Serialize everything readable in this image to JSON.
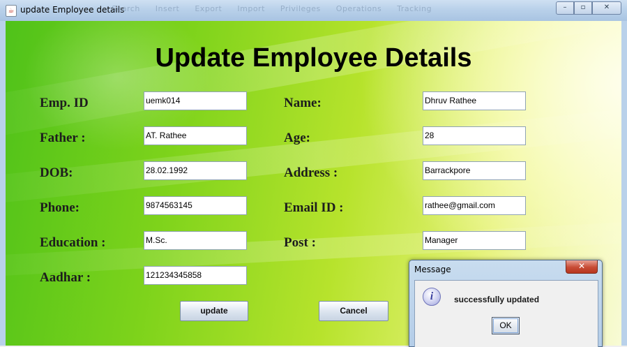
{
  "window": {
    "title": "update Employee details",
    "icon": "java-cup-icon",
    "background_toolbar_ghost": [
      "Search",
      "Insert",
      "Export",
      "Import",
      "Privileges",
      "Operations",
      "Tracking"
    ],
    "controls": {
      "minimize": "–",
      "maximize": "▫",
      "close": "✕"
    }
  },
  "form": {
    "heading": "Update Employee Details",
    "left_fields": [
      {
        "label": "Emp. ID",
        "value": "uemk014"
      },
      {
        "label": "Father :",
        "value": "AT. Rathee"
      },
      {
        "label": "DOB:",
        "value": "28.02.1992"
      },
      {
        "label": "Phone:",
        "value": "9874563145"
      },
      {
        "label": "Education :",
        "value": "M.Sc."
      },
      {
        "label": "Aadhar :",
        "value": "121234345858"
      }
    ],
    "right_fields": [
      {
        "label": "Name:",
        "value": "Dhruv Rathee"
      },
      {
        "label": "Age:",
        "value": "28"
      },
      {
        "label": "Address :",
        "value": "Barrackpore"
      },
      {
        "label": "Email ID :",
        "value": "rathee@gmail.com"
      },
      {
        "label": "Post :",
        "value": "Manager"
      }
    ],
    "buttons": {
      "update": "update",
      "cancel": "Cancel"
    }
  },
  "dialog": {
    "title": "Message",
    "close": "✕",
    "icon": "info-icon",
    "icon_glyph": "i",
    "message": "successfully updated",
    "ok": "OK"
  },
  "colors": {
    "background_green": "#7ed31b",
    "background_light": "#f8fbd6",
    "titlebar": "#b9d1ea",
    "dialog_close": "#c74b35"
  }
}
